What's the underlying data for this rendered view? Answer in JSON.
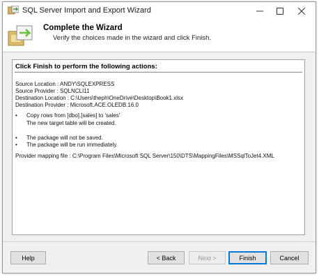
{
  "window": {
    "title": "SQL Server Import and Export Wizard"
  },
  "header": {
    "title": "Complete the Wizard",
    "subtitle": "Verify the choices made in the wizard and click Finish."
  },
  "content": {
    "heading": "Click Finish to perform the following actions:",
    "source_location": "Source Location : ANDY\\SQLEXPRESS",
    "source_provider": "Source Provider : SQLNCLI11",
    "destination_location": "Destination Location : C:\\Users\\theph\\OneDrive\\Desktop\\Book1.xlsx",
    "destination_provider": "Destination Provider : Microsoft.ACE.OLEDB.16.0",
    "bullet_char": "•",
    "copy_rows": "Copy rows from [dbo].[sales] to 'sales'",
    "new_table": "The new target table will be created.",
    "not_saved": "The package will not be saved.",
    "run_immediately": "The package will be run immediately.",
    "mapping_file": "Provider mapping file : C:\\Program Files\\Microsoft SQL Server\\150\\DTS\\MappingFiles\\MSSqlToJet4.XML"
  },
  "buttons": {
    "help": "Help",
    "back": "< Back",
    "next": "Next >",
    "finish": "Finish",
    "cancel": "Cancel"
  },
  "icons": {
    "app": "sql-server-wizard-icon",
    "wizard": "wizard-page-icon",
    "minimize": "minimize-icon",
    "maximize": "maximize-icon",
    "close": "close-icon"
  }
}
